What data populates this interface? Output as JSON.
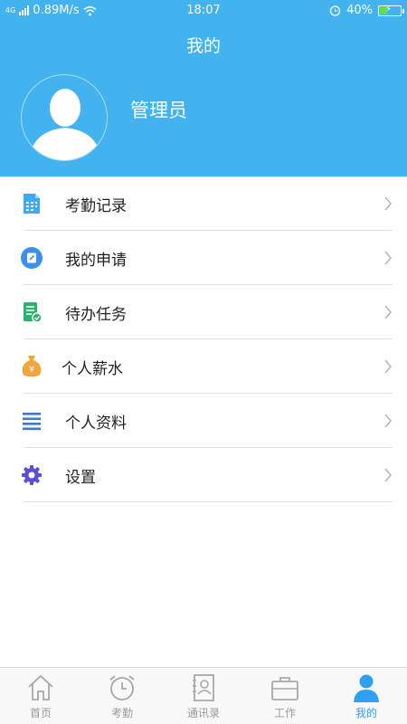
{
  "status_bar": {
    "network_type": "4G",
    "speed": "0.89M/s",
    "time": "18:07",
    "battery": "40%",
    "battery_level": 0.4
  },
  "header": {
    "title": "我的",
    "username": "管理员"
  },
  "menu": [
    {
      "label": "考勤记录",
      "icon": "attendance-record-icon",
      "color": "#3fa9f5"
    },
    {
      "label": "我的申请",
      "icon": "my-application-icon",
      "color": "#3a92e8"
    },
    {
      "label": "待办任务",
      "icon": "todo-task-icon",
      "color": "#2cb36b"
    },
    {
      "label": "个人薪水",
      "icon": "salary-bag-icon",
      "color": "#f0a63a"
    },
    {
      "label": "个人资料",
      "icon": "profile-list-icon",
      "color": "#3a78d8"
    },
    {
      "label": "设置",
      "icon": "gear-icon",
      "color": "#5b4fd8"
    }
  ],
  "tabs": [
    {
      "label": "首页",
      "icon": "home-icon",
      "active": false
    },
    {
      "label": "考勤",
      "icon": "alarm-clock-icon",
      "active": false
    },
    {
      "label": "通讯录",
      "icon": "contacts-icon",
      "active": false
    },
    {
      "label": "工作",
      "icon": "briefcase-icon",
      "active": false
    },
    {
      "label": "我的",
      "icon": "person-icon",
      "active": true
    }
  ],
  "colors": {
    "header_bg": "#43b3f0",
    "active_tab": "#2f9ff0",
    "inactive_tab": "#9a9a9a"
  }
}
